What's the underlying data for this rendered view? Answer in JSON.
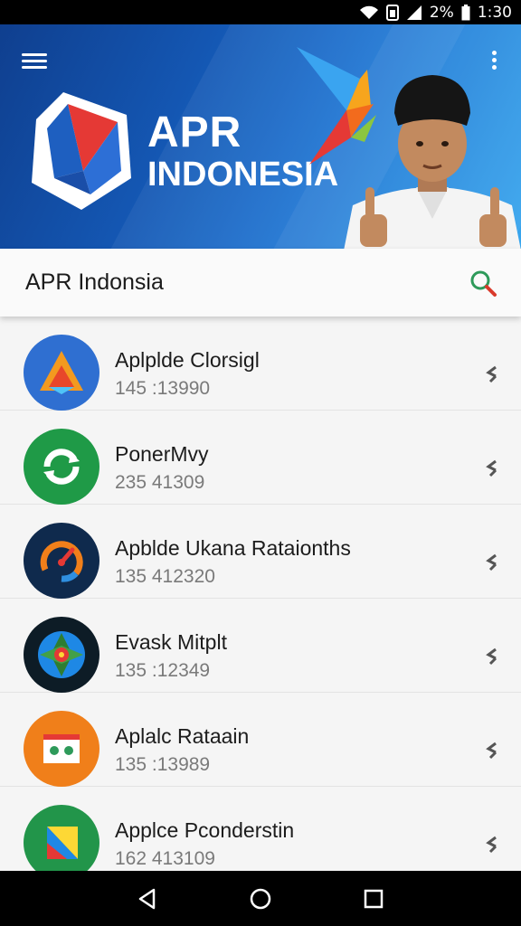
{
  "status_bar": {
    "battery_percent": "2%",
    "time": "1:30",
    "icons": [
      "wifi-icon",
      "sim-icon",
      "signal-icon",
      "battery-icon"
    ]
  },
  "banner": {
    "brand_line1": "APR",
    "brand_line2": "INDONESIA",
    "menu_icon": "hamburger-icon",
    "overflow_icon": "more-vert-icon"
  },
  "search_bar": {
    "title": "APR Indonsia",
    "icon": "search-icon"
  },
  "list": {
    "items": [
      {
        "name": "Aplplde Clorsigl",
        "number": "145 :13990",
        "color": "#2f6fd1",
        "icon": "triangle-logo-icon"
      },
      {
        "name": "PonerMvy",
        "number": "235 41309",
        "color": "#1f9a47",
        "icon": "sync-arrows-icon"
      },
      {
        "name": "Apblde Ukana Rataionths",
        "number": "135 412320",
        "color": "#0f2a4d",
        "icon": "gauge-icon"
      },
      {
        "name": "Evask Mitplt",
        "number": "135 :12349",
        "color": "#0d1c26",
        "icon": "compass-icon"
      },
      {
        "name": "Aplalc Rataain",
        "number": "135 :13989",
        "color": "#f07f1a",
        "icon": "folder-icon"
      },
      {
        "name": "Applce Pconderstin",
        "number": "162 413109",
        "color": "#22954a",
        "icon": "play-triangle-icon"
      }
    ]
  },
  "nav_bar": {
    "icons": [
      "back-icon",
      "home-icon",
      "recents-icon"
    ]
  },
  "colors": {
    "banner_blue": "#1457b3",
    "accent_red": "#e53935",
    "list_background": "#f5f5f5"
  }
}
